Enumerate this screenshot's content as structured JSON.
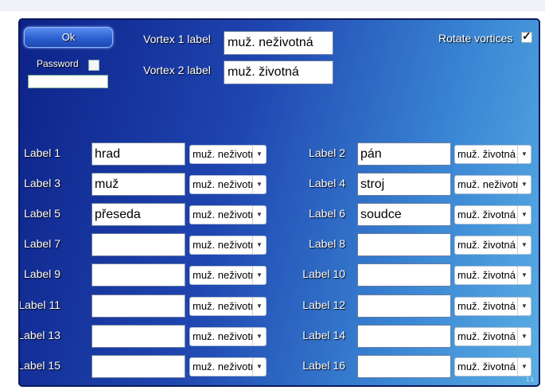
{
  "ok_label": "Ok",
  "password": {
    "label": "Password",
    "value": "",
    "checked": false
  },
  "vortex1": {
    "label": "Vortex 1 label",
    "value": "muž. neživotná"
  },
  "vortex2": {
    "label": "Vortex 2 label",
    "value": "muž. životná"
  },
  "rotate": {
    "label": "Rotate vortices",
    "checked": true,
    "mark": "✓"
  },
  "labels": [
    {
      "label": "Label 1",
      "value": "hrad",
      "select": "muž. neživotná"
    },
    {
      "label": "Label 2",
      "value": "pán",
      "select": "muž. životná"
    },
    {
      "label": "Label 3",
      "value": "muž",
      "select": "muž. neživotná"
    },
    {
      "label": "Label 4",
      "value": "stroj",
      "select": "muž. neživotná"
    },
    {
      "label": "Label 5",
      "value": "přeseda",
      "select": "muž. neživotná"
    },
    {
      "label": "Label 6",
      "value": "soudce",
      "select": "muž. životná"
    },
    {
      "label": "Label 7",
      "value": "",
      "select": "muž. neživotná"
    },
    {
      "label": "Label 8",
      "value": "",
      "select": "muž. životná"
    },
    {
      "label": "Label 9",
      "value": "",
      "select": "muž. neživotná"
    },
    {
      "label": "Label 10",
      "value": "",
      "select": "muž. životná"
    },
    {
      "label": "Label 11",
      "value": "",
      "select": "muž. neživotná"
    },
    {
      "label": "Label 12",
      "value": "",
      "select": "muž. životná"
    },
    {
      "label": "Label 13",
      "value": "",
      "select": "muž. neživotná"
    },
    {
      "label": "Label 14",
      "value": "",
      "select": "muž. životná"
    },
    {
      "label": "Label 15",
      "value": "",
      "select": "muž. neživotná"
    },
    {
      "label": "Label 16",
      "value": "",
      "select": "muž. životná"
    }
  ],
  "dropdown_arrow": "▼",
  "version": "1.1"
}
